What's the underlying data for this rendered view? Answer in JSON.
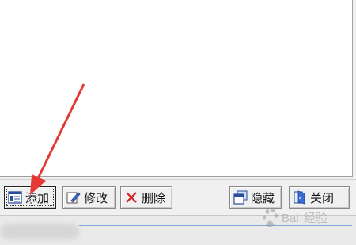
{
  "toolbar": {
    "add_label": "添加",
    "edit_label": "修改",
    "delete_label": "删除",
    "hide_label": "隐藏",
    "close_label": "关闭"
  },
  "annotation": {
    "arrow_color": "#e53935"
  },
  "icons": {
    "add": "list-icon",
    "edit": "pencil-icon",
    "delete": "x-icon",
    "hide": "windows-icon",
    "close": "door-icon"
  }
}
